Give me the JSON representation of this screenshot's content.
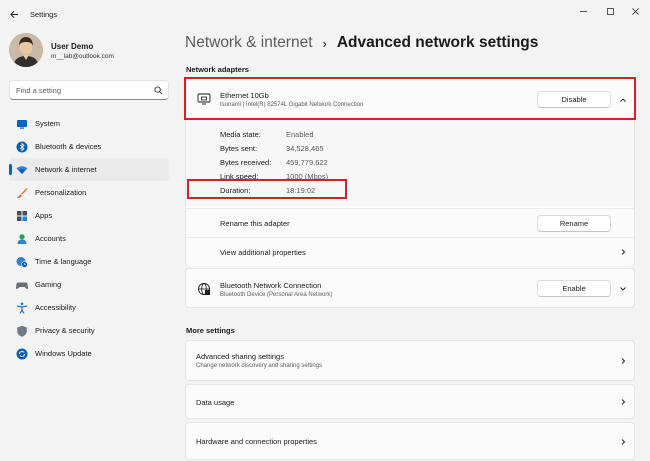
{
  "window": {
    "title": "Settings"
  },
  "user": {
    "name": "User Demo",
    "email": "m__lab@outlook.com"
  },
  "search": {
    "placeholder": "Find a setting"
  },
  "sidebar": {
    "items": [
      {
        "label": "System",
        "icon": "monitor-icon"
      },
      {
        "label": "Bluetooth & devices",
        "icon": "bluetooth-icon"
      },
      {
        "label": "Network & internet",
        "icon": "wifi-icon",
        "active": true
      },
      {
        "label": "Personalization",
        "icon": "brush-icon"
      },
      {
        "label": "Apps",
        "icon": "apps-icon"
      },
      {
        "label": "Accounts",
        "icon": "person-icon"
      },
      {
        "label": "Time & language",
        "icon": "globe-clock-icon"
      },
      {
        "label": "Gaming",
        "icon": "gamepad-icon"
      },
      {
        "label": "Accessibility",
        "icon": "accessibility-icon"
      },
      {
        "label": "Privacy & security",
        "icon": "shield-icon"
      },
      {
        "label": "Windows Update",
        "icon": "update-icon"
      }
    ]
  },
  "breadcrumb": {
    "parent": "Network & internet",
    "separator": "›",
    "current": "Advanced network settings"
  },
  "sections": {
    "adapters": "Network adapters",
    "more": "More settings"
  },
  "ethernet": {
    "name": "Ethernet 10Gb",
    "description": "tsunami | Intel(R) 82574L Gigabit Network Connection",
    "button": "Disable",
    "details": [
      {
        "key": "Media state:",
        "value": "Enabled"
      },
      {
        "key": "Bytes sent:",
        "value": "34,528,465"
      },
      {
        "key": "Bytes received:",
        "value": "459,779,622"
      },
      {
        "key": "Link speed:",
        "value": "1000 (Mbps)"
      },
      {
        "key": "Duration:",
        "value": "18:19:02"
      }
    ],
    "rename_label": "Rename this adapter",
    "rename_button": "Rename",
    "view_props_label": "View additional properties"
  },
  "bluetooth": {
    "name": "Bluetooth Network Connection",
    "description": "Bluetooth Device (Personal Area Network)",
    "button": "Enable"
  },
  "more_settings": [
    {
      "title": "Advanced sharing settings",
      "subtitle": "Change network discovery and sharing settings"
    },
    {
      "title": "Data usage",
      "subtitle": ""
    },
    {
      "title": "Hardware and connection properties",
      "subtitle": ""
    }
  ],
  "colors": {
    "accent": "#0067c0",
    "highlight": "#d0212d"
  }
}
